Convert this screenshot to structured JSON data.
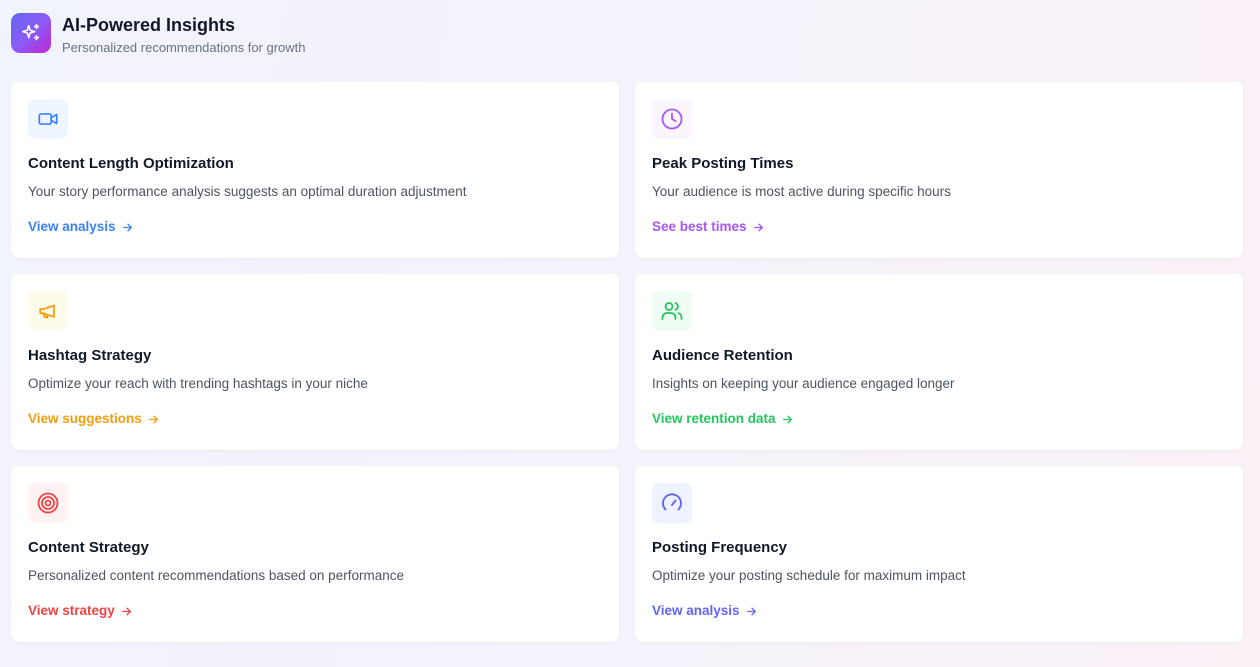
{
  "header": {
    "title": "AI-Powered Insights",
    "subtitle": "Personalized recommendations for growth",
    "icon": "sparkles-icon"
  },
  "cards": [
    {
      "title": "Content Length Optimization",
      "description": "Your story performance analysis suggests an optimal duration adjustment",
      "link": "View analysis",
      "icon": "video-icon",
      "color": "#3b82f6",
      "bg": "#eff6ff"
    },
    {
      "title": "Peak Posting Times",
      "description": "Your audience is most active during specific hours",
      "link": "See best times",
      "icon": "clock-icon",
      "color": "#a855f7",
      "bg": "#faf5ff"
    },
    {
      "title": "Hashtag Strategy",
      "description": "Optimize your reach with trending hashtags in your niche",
      "link": "View suggestions",
      "icon": "megaphone-icon",
      "color": "#f59e0b",
      "bg": "#fffbeb"
    },
    {
      "title": "Audience Retention",
      "description": "Insights on keeping your audience engaged longer",
      "link": "View retention data",
      "icon": "users-icon",
      "color": "#22c55e",
      "bg": "#f0fdf4"
    },
    {
      "title": "Content Strategy",
      "description": "Personalized content recommendations based on performance",
      "link": "View strategy",
      "icon": "target-icon",
      "color": "#ef4444",
      "bg": "#fef2f2"
    },
    {
      "title": "Posting Frequency",
      "description": "Optimize your posting schedule for maximum impact",
      "link": "View analysis",
      "icon": "gauge-icon",
      "color": "#6366f1",
      "bg": "#eef2ff"
    }
  ]
}
